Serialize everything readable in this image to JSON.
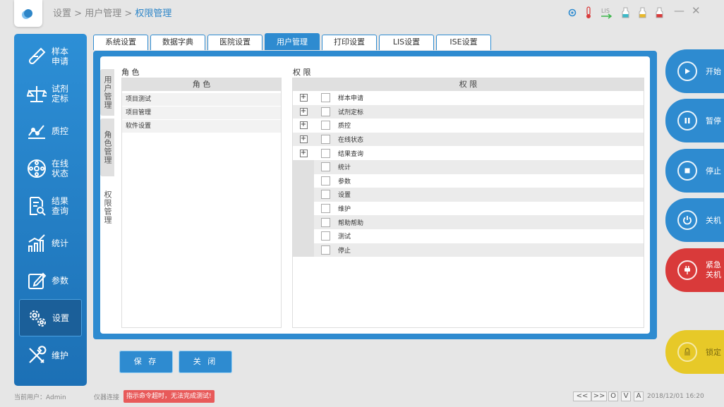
{
  "header": {
    "breadcrumb_root": "设置",
    "breadcrumb_sep1": ">",
    "breadcrumb_mid": "用户管理",
    "breadcrumb_sep2": ">",
    "breadcrumb_current": "权限管理",
    "minimize": "—",
    "close": "✕"
  },
  "sidebar": {
    "items": [
      {
        "label": "样本\n申请",
        "icon": "sample-tube-icon"
      },
      {
        "label": "试剂\n定标",
        "icon": "balance-scale-icon"
      },
      {
        "label": "质控",
        "icon": "chart-line-icon"
      },
      {
        "label": "在线\n状态",
        "icon": "dial-icon"
      },
      {
        "label": "结果\n查询",
        "icon": "document-search-icon"
      },
      {
        "label": "统计",
        "icon": "bar-chart-icon"
      },
      {
        "label": "参数",
        "icon": "edit-icon"
      },
      {
        "label": "设置",
        "icon": "gears-icon"
      },
      {
        "label": "维护",
        "icon": "tools-icon"
      }
    ],
    "active_index": 7
  },
  "tabs": [
    "系统设置",
    "数据字典",
    "医院设置",
    "用户管理",
    "打印设置",
    "LIS设置",
    "ISE设置"
  ],
  "active_tab": 3,
  "vtabs": [
    "用户管理",
    "角色管理",
    "权限管理"
  ],
  "role_panel": {
    "title": "角 色",
    "header": "角 色",
    "rows": [
      "项目测试",
      "项目管理",
      "软件设置"
    ]
  },
  "perm_panel": {
    "title": "权 限",
    "header": "权 限",
    "rows": [
      {
        "label": "样本申请",
        "expandable": true
      },
      {
        "label": "试剂定标",
        "expandable": true
      },
      {
        "label": "质控",
        "expandable": true
      },
      {
        "label": "在线状态",
        "expandable": true
      },
      {
        "label": "结果查询",
        "expandable": true
      },
      {
        "label": "统计",
        "expandable": false
      },
      {
        "label": "参数",
        "expandable": false
      },
      {
        "label": "设置",
        "expandable": false
      },
      {
        "label": "维护",
        "expandable": false
      },
      {
        "label": "帮助帮助",
        "expandable": false
      },
      {
        "label": "测试",
        "expandable": false
      },
      {
        "label": "停止",
        "expandable": false
      }
    ]
  },
  "buttons": {
    "save": "保 存",
    "close": "关 闭"
  },
  "right_buttons": [
    {
      "label": "开始",
      "icon": "play-icon"
    },
    {
      "label": "暂停",
      "icon": "pause-icon"
    },
    {
      "label": "停止",
      "icon": "stop-icon"
    },
    {
      "label": "关机",
      "icon": "power-icon"
    },
    {
      "label": "紧急\n关机",
      "icon": "plug-icon"
    },
    {
      "label": "锁定",
      "icon": "lock-icon"
    }
  ],
  "footer": {
    "current_user": "当前用户：Admin",
    "instrument": "仪器连接",
    "alert": "指示命令超时，无法完成测试!",
    "datetime": "2018/12/01 16:20",
    "controls": [
      "<<",
      ">>",
      "O",
      "V",
      "A"
    ]
  },
  "colors": {
    "primary": "#2e8bd0",
    "danger": "#d93a3a",
    "lock": "#e7c928"
  }
}
